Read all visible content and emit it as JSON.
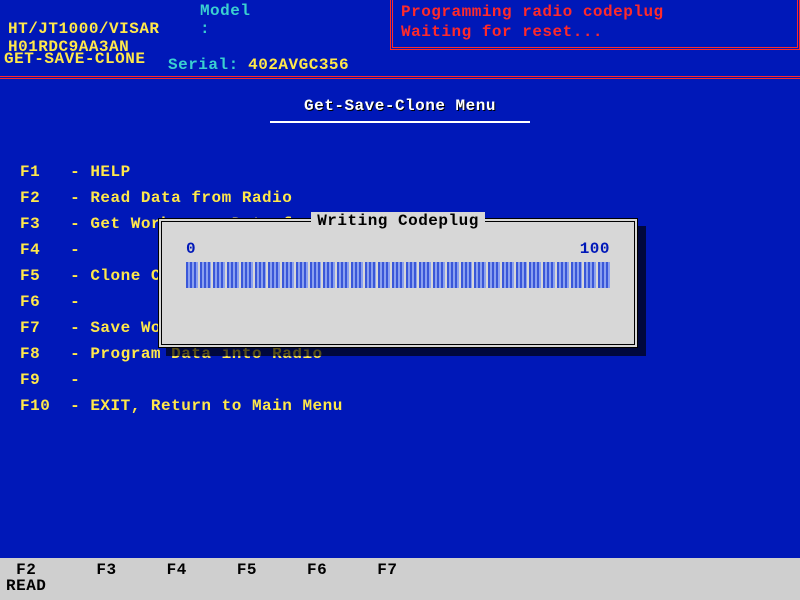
{
  "header": {
    "device_line": "HT/JT1000/VISAR",
    "model_label": "Model :",
    "model_value": "H01RDC9AA3AN",
    "serial_label": "Serial:",
    "serial_value": "402AVGC356",
    "status_line1": "Programming radio codeplug",
    "status_line2": "Waiting for reset..."
  },
  "breadcrumb": "GET-SAVE-CLONE",
  "title": "Get-Save-Clone Menu",
  "menu": [
    {
      "key": "F1",
      "label": "HELP"
    },
    {
      "key": "F2",
      "label": "Read Data from Radio"
    },
    {
      "key": "F3",
      "label": "Get Workspace Data from Archive File"
    },
    {
      "key": "F4",
      "label": ""
    },
    {
      "key": "F5",
      "label": "Clone Codeplug"
    },
    {
      "key": "F6",
      "label": ""
    },
    {
      "key": "F7",
      "label": "Save Workspace Data to Archive File"
    },
    {
      "key": "F8",
      "label": "Program Data into Radio"
    },
    {
      "key": "F9",
      "label": ""
    },
    {
      "key": "F10",
      "label": "EXIT, Return to Main Menu"
    }
  ],
  "dialog": {
    "title": "Writing Codeplug",
    "scale_min": "0",
    "scale_max": "100",
    "progress_segments": 31,
    "progress_percent": 100
  },
  "fkeys": [
    {
      "key": "F2",
      "label": "READ"
    },
    {
      "key": "F3",
      "label": ""
    },
    {
      "key": "F4",
      "label": ""
    },
    {
      "key": "F5",
      "label": ""
    },
    {
      "key": "F6",
      "label": ""
    },
    {
      "key": "F7",
      "label": ""
    }
  ]
}
